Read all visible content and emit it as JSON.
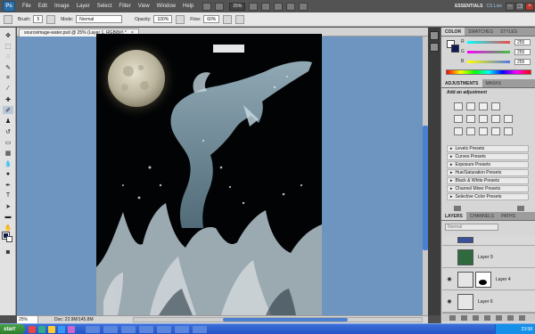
{
  "app": {
    "logo": "Ps",
    "menu": [
      "File",
      "Edit",
      "Image",
      "Layer",
      "Select",
      "Filter",
      "View",
      "Window",
      "Help"
    ],
    "zoom_select": "25%",
    "workspace": "ESSENTIALS",
    "cs_live": "CS Live",
    "window_controls": [
      "minimize-icon",
      "restore-icon",
      "close-icon"
    ]
  },
  "options_bar": {
    "brush_label": "Brush:",
    "brush_size": "5",
    "mode_label": "Mode:",
    "mode_value": "Normal",
    "opacity_label": "Opacity:",
    "opacity_value": "100%",
    "flow_label": "Flow:",
    "flow_value": "60%"
  },
  "document": {
    "tab_title": "sourceimage-water.psd @ 25% (Layer 1, RGB/8#) *",
    "tab_close": "×",
    "status_zoom": "25%",
    "status_doc": "Doc: 22.9M/145.8M",
    "canvas_bg": "#020305",
    "workspace_bg": "#6e95bf",
    "scroll_accent": "#4b7fcf"
  },
  "panels": {
    "color": {
      "tabs": [
        "COLOR",
        "SWATCHES",
        "STYLES"
      ],
      "active_tab": "COLOR",
      "channels": [
        {
          "label": "R",
          "value": "255",
          "track_color": "#f04848"
        },
        {
          "label": "G",
          "value": "255",
          "track_color": "#3fc43f"
        },
        {
          "label": "B",
          "value": "255",
          "track_color": "#4f79e8"
        }
      ]
    },
    "adjustments": {
      "tabs": [
        "ADJUSTMENTS",
        "MASKS"
      ],
      "active_tab": "ADJUSTMENTS",
      "title": "Add an adjustment",
      "presets": [
        "Levels Presets",
        "Curves Presets",
        "Exposure Presets",
        "Hue/Saturation Presets",
        "Black & White Presets",
        "Channel Mixer Presets",
        "Selective Color Presets"
      ]
    },
    "layers": {
      "tabs": [
        "LAYERS",
        "CHANNELS",
        "PATHS"
      ],
      "active_tab": "LAYERS",
      "blend_mode": "Normal",
      "items": [
        {
          "name": "Layer 9",
          "thumb_color": "#2f6a3e",
          "visible": false,
          "selected": false
        },
        {
          "name": "Layer 4",
          "thumb_color": "#e6e6e6",
          "visible": true,
          "selected": false,
          "has_mask": true
        },
        {
          "name": "Layer 6",
          "thumb_color": "#e6e6e6",
          "visible": true,
          "selected": false
        }
      ]
    }
  },
  "taskbar": {
    "start_label": "start",
    "clock": "23:58"
  }
}
